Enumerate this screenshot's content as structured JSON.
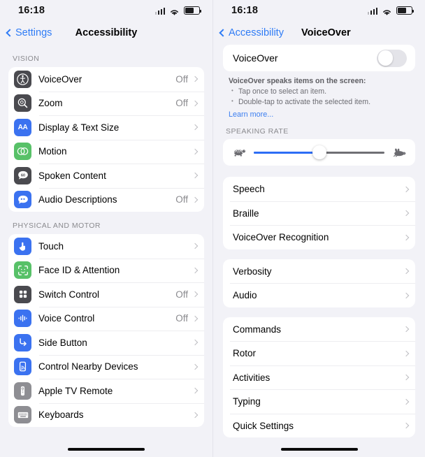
{
  "left": {
    "statusbar": {
      "time": "16:18",
      "signal_icon": "cellular-signal-icon",
      "wifi_icon": "wifi-icon",
      "battery_icon": "battery-icon"
    },
    "nav": {
      "back_label": "Settings",
      "title": "Accessibility"
    },
    "sections": [
      {
        "header": "VISION",
        "rows": [
          {
            "label": "VoiceOver",
            "value": "Off",
            "icon": "voiceover-icon",
            "icon_color": "#4a4a4f"
          },
          {
            "label": "Zoom",
            "value": "Off",
            "icon": "zoom-magnifier-icon",
            "icon_color": "#4a4a4f"
          },
          {
            "label": "Display & Text Size",
            "value": "",
            "icon": "display-text-size-icon",
            "icon_color": "#3b72f0"
          },
          {
            "label": "Motion",
            "value": "",
            "icon": "motion-icon",
            "icon_color": "#58c168"
          },
          {
            "label": "Spoken Content",
            "value": "",
            "icon": "spoken-content-icon",
            "icon_color": "#4a4a4f"
          },
          {
            "label": "Audio Descriptions",
            "value": "Off",
            "icon": "audio-descriptions-icon",
            "icon_color": "#3b72f0"
          }
        ]
      },
      {
        "header": "PHYSICAL AND MOTOR",
        "rows": [
          {
            "label": "Touch",
            "value": "",
            "icon": "touch-hand-icon",
            "icon_color": "#3b72f0"
          },
          {
            "label": "Face ID & Attention",
            "value": "",
            "icon": "face-id-icon",
            "icon_color": "#58c168"
          },
          {
            "label": "Switch Control",
            "value": "Off",
            "icon": "switch-control-icon",
            "icon_color": "#4a4a4f"
          },
          {
            "label": "Voice Control",
            "value": "Off",
            "icon": "voice-control-icon",
            "icon_color": "#3b72f0"
          },
          {
            "label": "Side Button",
            "value": "",
            "icon": "side-button-icon",
            "icon_color": "#3b72f0"
          },
          {
            "label": "Control Nearby Devices",
            "value": "",
            "icon": "control-nearby-devices-icon",
            "icon_color": "#3b72f0"
          },
          {
            "label": "Apple TV Remote",
            "value": "",
            "icon": "apple-tv-remote-icon",
            "icon_color": "#8e8e93"
          },
          {
            "label": "Keyboards",
            "value": "",
            "icon": "keyboard-icon",
            "icon_color": "#8e8e93"
          }
        ]
      }
    ]
  },
  "right": {
    "statusbar": {
      "time": "16:18",
      "signal_icon": "cellular-signal-icon",
      "wifi_icon": "wifi-icon",
      "battery_icon": "battery-icon"
    },
    "nav": {
      "back_label": "Accessibility",
      "title": "VoiceOver"
    },
    "toggle": {
      "label": "VoiceOver",
      "state": "off"
    },
    "description": {
      "heading": "VoiceOver speaks items on the screen:",
      "bullets": [
        "Tap once to select an item.",
        "Double-tap to activate the selected item."
      ],
      "learn_more": "Learn more..."
    },
    "speaking_rate": {
      "header": "SPEAKING RATE",
      "slow_icon": "tortoise-icon",
      "fast_icon": "hare-icon",
      "value_percent": 50,
      "fill_color": "#2d6df6",
      "track_color": "#6f6f74"
    },
    "groups": [
      {
        "rows": [
          {
            "label": "Speech"
          },
          {
            "label": "Braille"
          },
          {
            "label": "VoiceOver Recognition"
          }
        ]
      },
      {
        "rows": [
          {
            "label": "Verbosity"
          },
          {
            "label": "Audio"
          }
        ]
      },
      {
        "rows": [
          {
            "label": "Commands"
          },
          {
            "label": "Rotor"
          },
          {
            "label": "Activities"
          },
          {
            "label": "Typing"
          },
          {
            "label": "Quick Settings"
          }
        ]
      }
    ]
  }
}
